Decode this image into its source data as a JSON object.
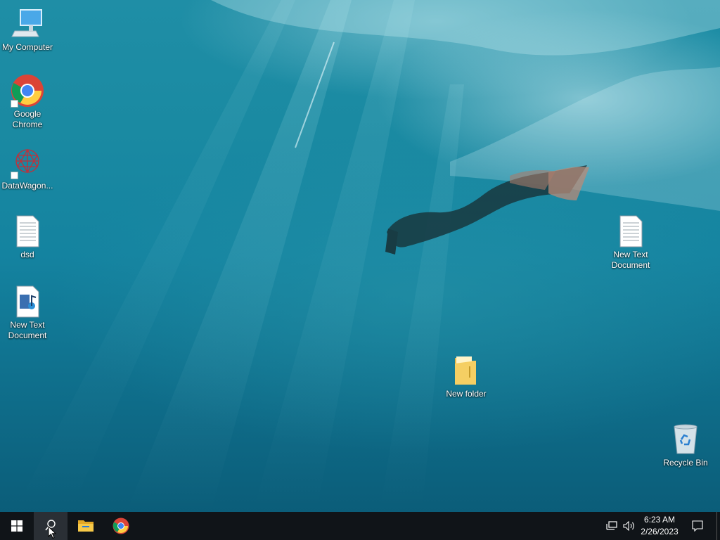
{
  "desktop": {
    "icons": [
      {
        "label": "My Computer",
        "icon": "computer-icon"
      },
      {
        "label": "Google\nChrome",
        "icon": "chrome-icon"
      },
      {
        "label": "DataWagon...",
        "icon": "datawagon-icon"
      },
      {
        "label": "dsd",
        "icon": "text-file-icon"
      },
      {
        "label": "New Text\nDocument",
        "icon": "media-file-icon"
      },
      {
        "label": "New Text\nDocument",
        "icon": "text-file-icon"
      },
      {
        "label": "New folder",
        "icon": "folder-icon"
      },
      {
        "label": "Recycle Bin",
        "icon": "recycle-bin-icon"
      }
    ]
  },
  "taskbar": {
    "start": "windows-start-icon",
    "search": "search-icon",
    "pinned": [
      "file-explorer-icon",
      "chrome-icon"
    ],
    "tray": {
      "network": "network-icon",
      "volume": "volume-icon",
      "time": "6:23 AM",
      "date": "2/26/2023",
      "notifications": "action-center-icon"
    }
  },
  "colors": {
    "taskbar": "#101418",
    "water_top": "#1f8ea6",
    "water_bottom": "#0b5d79"
  }
}
